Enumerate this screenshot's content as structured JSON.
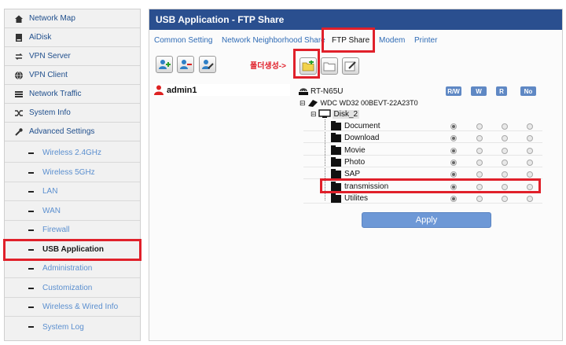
{
  "sidebar": {
    "top_items": [
      {
        "label": "Network Map",
        "icon": "home-icon"
      },
      {
        "label": "AiDisk",
        "icon": "disk-icon"
      },
      {
        "label": "VPN Server",
        "icon": "vpn-server-icon"
      },
      {
        "label": "VPN Client",
        "icon": "vpn-client-icon"
      },
      {
        "label": "Network Traffic",
        "icon": "traffic-icon"
      },
      {
        "label": "System Info",
        "icon": "system-info-icon"
      },
      {
        "label": "Advanced Settings",
        "icon": "wrench-icon"
      }
    ],
    "sub_items": [
      {
        "label": "Wireless 2.4GHz"
      },
      {
        "label": "Wireless 5GHz"
      },
      {
        "label": "LAN"
      },
      {
        "label": "WAN"
      },
      {
        "label": "Firewall"
      },
      {
        "label": "USB Application"
      },
      {
        "label": "Administration"
      },
      {
        "label": "Customization"
      },
      {
        "label": "Wireless & Wired Info"
      },
      {
        "label": "System Log"
      }
    ],
    "active_sub": "USB Application"
  },
  "main": {
    "title": "USB Application - FTP Share",
    "tabs": [
      {
        "label": "Common Setting"
      },
      {
        "label": "Network Neighborhood Share"
      },
      {
        "label": "FTP Share"
      },
      {
        "label": "Modem"
      },
      {
        "label": "Printer"
      }
    ],
    "active_tab": "FTP Share",
    "annotation": "폴더생성->",
    "user": "admin1",
    "tree": {
      "router": "RT-N65U",
      "drive": "WDC WD32 00BEVT-22A23T0",
      "disk": "Disk_2",
      "folders": [
        {
          "name": "Document",
          "perm": "R/W"
        },
        {
          "name": "Download",
          "perm": "R/W"
        },
        {
          "name": "Movie",
          "perm": "R/W"
        },
        {
          "name": "Photo",
          "perm": "R/W"
        },
        {
          "name": "SAP",
          "perm": "R/W"
        },
        {
          "name": "transmission",
          "perm": "R/W"
        },
        {
          "name": "Utilites",
          "perm": "R/W"
        }
      ]
    },
    "permission_headers": [
      "R/W",
      "W",
      "R",
      "No"
    ],
    "apply_label": "Apply"
  },
  "colors": {
    "title_bar": "#2a4f8f",
    "link": "#2f6bb5",
    "highlight": "#e0202a",
    "apply": "#6d98d6"
  }
}
